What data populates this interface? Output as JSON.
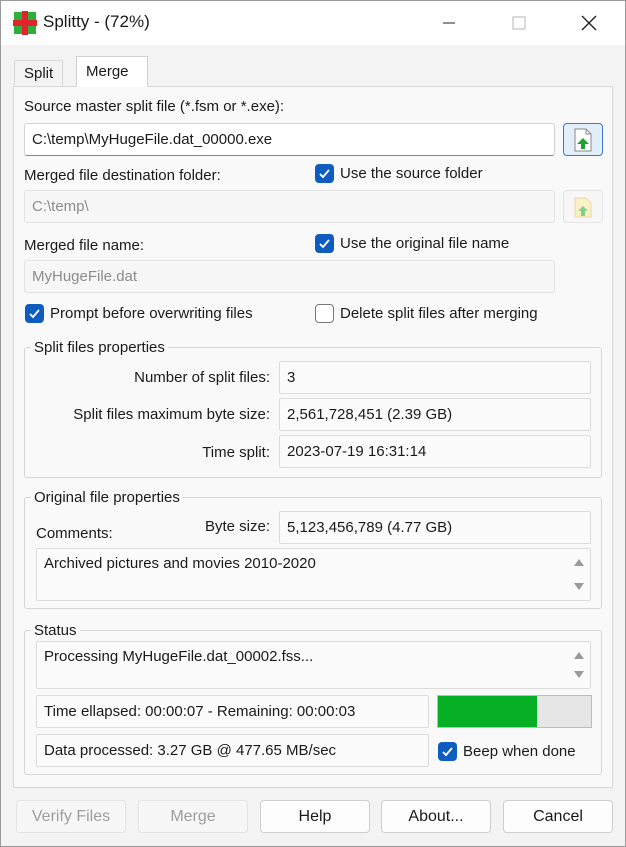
{
  "window": {
    "title": "Splitty - (72%)"
  },
  "tabs": [
    {
      "label": "Split"
    },
    {
      "label": "Merge"
    }
  ],
  "merge": {
    "source_label": "Source master split file (*.fsm or *.exe):",
    "source_value": "C:\\temp\\MyHugeFile.dat_00000.exe",
    "dest_label": "Merged file destination folder:",
    "use_source_folder": {
      "label": "Use the source folder",
      "checked": true
    },
    "dest_value": "C:\\temp\\",
    "name_label": "Merged file name:",
    "use_original_name": {
      "label": "Use the original file name",
      "checked": true
    },
    "name_value": "MyHugeFile.dat",
    "prompt_overwrite": {
      "label": "Prompt before overwriting files",
      "checked": true
    },
    "delete_after": {
      "label": "Delete split files after merging",
      "checked": false
    }
  },
  "split_props": {
    "title": "Split files properties",
    "count_label": "Number of split files:",
    "count_value": "3",
    "maxsize_label": "Split files maximum byte size:",
    "maxsize_value": "2,561,728,451 (2.39 GB)",
    "time_label": "Time split:",
    "time_value": "2023-07-19 16:31:14"
  },
  "orig_props": {
    "title": "Original file properties",
    "comments_label": "Comments:",
    "size_label": "Byte size:",
    "size_value": "5,123,456,789 (4.77 GB)",
    "comments_value": "Archived pictures and movies 2010-2020"
  },
  "status": {
    "title": "Status",
    "message": "Processing MyHugeFile.dat_00002.fss...",
    "time_text": "Time ellapsed: 00:00:07 - Remaining: 00:00:03",
    "progress_fraction": 0.65,
    "data_text": "Data processed: 3.27 GB @ 477.65 MB/sec",
    "beep": {
      "label": "Beep when done",
      "checked": true
    }
  },
  "buttons": {
    "verify": "Verify Files",
    "merge": "Merge",
    "help": "Help",
    "about": "About...",
    "cancel": "Cancel"
  },
  "colors": {
    "accent": "#0f5cc0",
    "progress": "#06b025"
  }
}
